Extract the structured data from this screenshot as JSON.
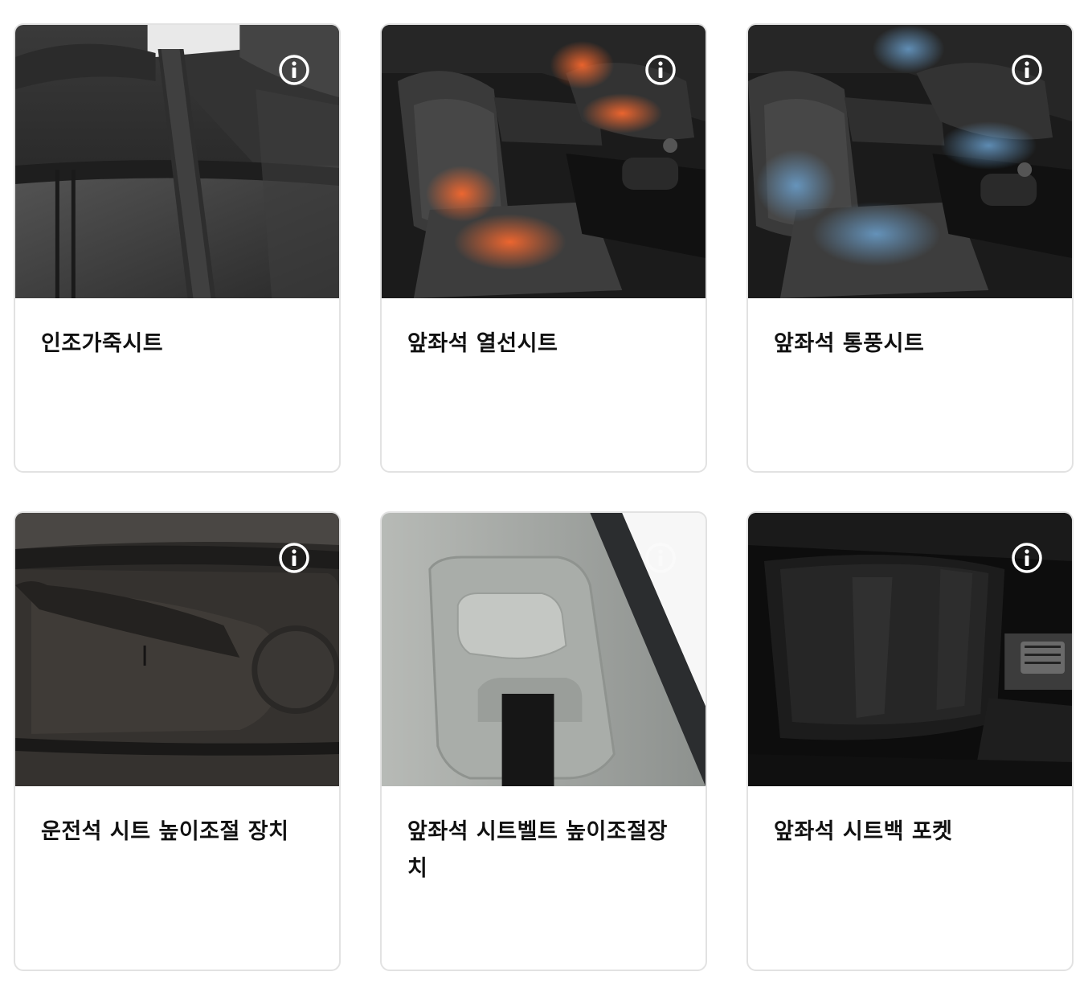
{
  "options": [
    {
      "title": "인조가죽시트",
      "info_icon": "info-circle-icon"
    },
    {
      "title": "앞좌석 열선시트",
      "info_icon": "info-circle-icon"
    },
    {
      "title": "앞좌석 통풍시트",
      "info_icon": "info-circle-icon"
    },
    {
      "title": "운전석 시트 높이조절 장치",
      "info_icon": "info-circle-icon"
    },
    {
      "title": "앞좌석 시트벨트 높이조절장치",
      "info_icon": "info-circle-icon"
    },
    {
      "title": "앞좌석 시트백 포켓",
      "info_icon": "info-circle-icon"
    }
  ],
  "colors": {
    "card_border": "#e2e2e2",
    "title_text": "#111111",
    "info_icon": "#ffffff",
    "heat_accent": "#e0582a",
    "vent_accent": "#5b8db8"
  }
}
